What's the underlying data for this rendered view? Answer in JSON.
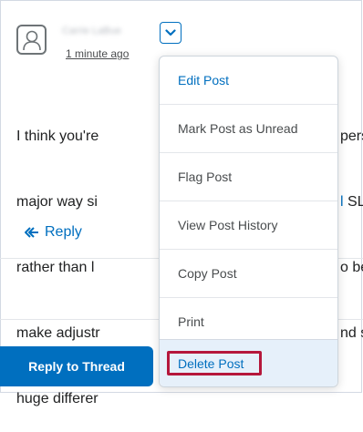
{
  "post": {
    "author_blurred": "Carrie LaBue",
    "timestamp": "1 minute ago",
    "body_lines": [
      "I think you're ",
      "major way si",
      "rather than l",
      "make adjustr",
      "huge differer"
    ],
    "body_right": [
      "pers",
      "SL",
      "o be",
      "nd s",
      ""
    ],
    "reply_label": "Reply"
  },
  "thread": {
    "reply_button": "Reply to Thread"
  },
  "menu": {
    "items": [
      "Edit Post",
      "Mark Post as Unread",
      "Flag Post",
      "View Post History",
      "Copy Post",
      "Print",
      "Delete Post"
    ]
  },
  "colors": {
    "accent": "#006fbf",
    "highlight_border": "#b5173b",
    "menu_selected_bg": "#e6f0fa"
  }
}
